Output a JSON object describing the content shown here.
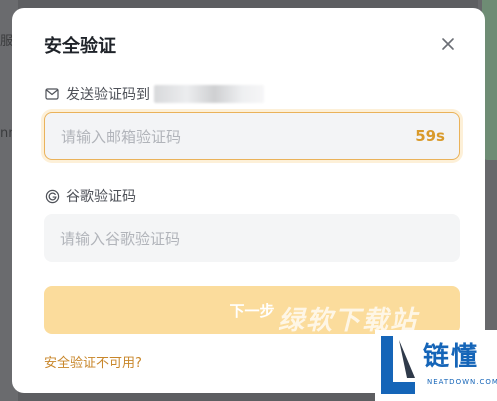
{
  "backdrop": {
    "left_text_1": "服",
    "left_text_2": "nn"
  },
  "modal": {
    "title": "安全验证",
    "close_icon": "close-icon",
    "email_label": "发送验证码到",
    "email_icon": "mail-icon",
    "email_code_placeholder": "请输入邮箱验证码",
    "countdown": "59s",
    "google_label": "谷歌验证码",
    "google_icon": "google-icon",
    "google_code_placeholder": "请输入谷歌验证码",
    "next_button": "下一步",
    "alt_link": "安全验证不可用?"
  },
  "watermark": {
    "text": "绿软下载站",
    "logo_cn": "链懂",
    "logo_en": "NEATDOWN.COM"
  },
  "colors": {
    "accent": "#d99a2b",
    "button_disabled": "#fbdc9c",
    "link": "#c8862a",
    "logo_blue": "#1565b8"
  }
}
